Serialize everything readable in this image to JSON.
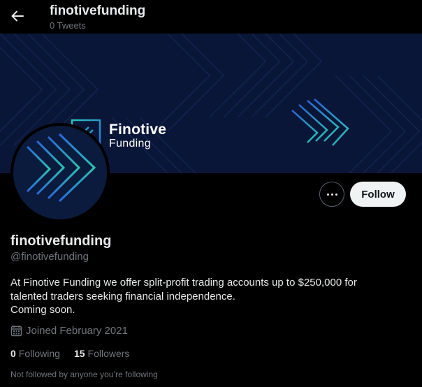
{
  "header": {
    "title": "finotivefunding",
    "tweet_count": "0 Tweets"
  },
  "banner": {
    "brand_line1": "Finotive",
    "brand_line2": "Funding"
  },
  "actions": {
    "follow_label": "Follow"
  },
  "profile": {
    "display_name": "finotivefunding",
    "handle": "@finotivefunding",
    "bio_lines": [
      "At Finotive Funding we offer split-profit trading accounts up to $250,000 for",
      "talented traders seeking financial independence.",
      "Coming soon."
    ],
    "joined": "Joined February 2021",
    "following_count": "0",
    "following_label": "Following",
    "followers_count": "15",
    "followers_label": "Followers",
    "not_followed_note": "Not followed by anyone you’re following"
  },
  "colors": {
    "background": "#000000",
    "banner": "#0a1637",
    "accent_teal": "#2bc4b4",
    "accent_blue": "#2a66d9",
    "muted_text": "#71767b",
    "follow_button": "#eff3f4"
  },
  "icons": {
    "back": "arrow-left-icon",
    "more": "more-dots-icon",
    "calendar": "calendar-icon",
    "logo": "finotive-logo-icon"
  }
}
